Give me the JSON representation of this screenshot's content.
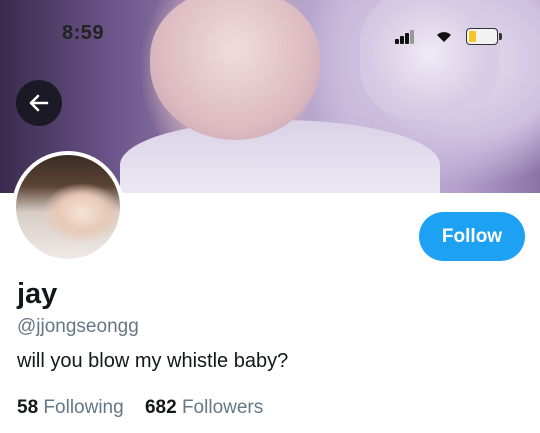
{
  "status_bar": {
    "time": "8:59",
    "battery_level": 0.25,
    "battery_color": "#f6c622"
  },
  "nav": {
    "back_icon": "arrow-left-icon"
  },
  "profile": {
    "display_name": "jay",
    "handle": "@jjongseongg",
    "bio": "will you blow my whistle baby?",
    "follow_label": "Follow",
    "following_count": "58",
    "following_label": "Following",
    "followers_count": "682",
    "followers_label": "Followers"
  },
  "colors": {
    "accent": "#1da1f2",
    "primary_text": "#14171a",
    "secondary_text": "#657786"
  }
}
